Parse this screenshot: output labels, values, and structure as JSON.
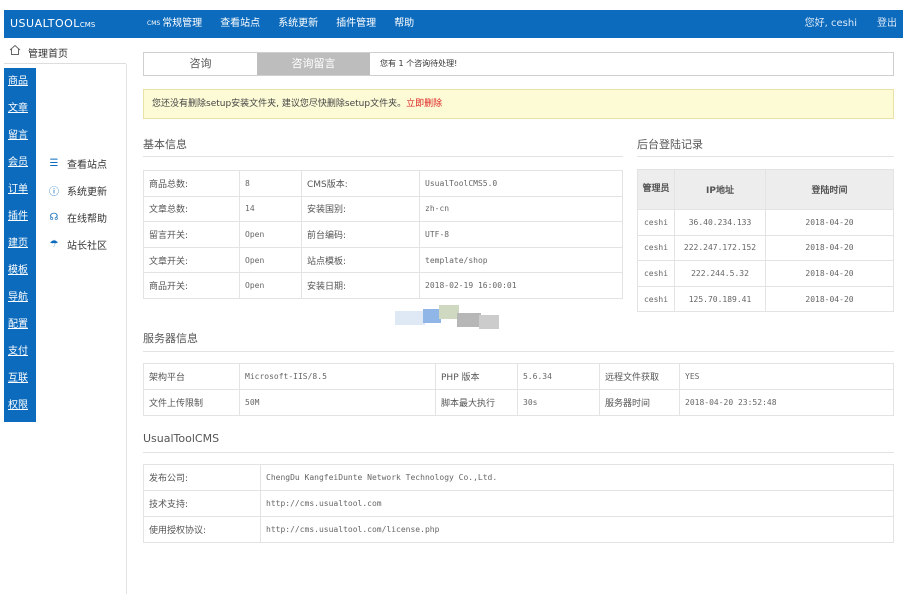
{
  "app": {
    "logo_main": "USUALTOOL",
    "logo_small": "CMS"
  },
  "topnav": {
    "items": [
      {
        "prefix": "CMS",
        "label": "常规管理"
      },
      {
        "prefix": "",
        "label": "查看站点"
      },
      {
        "prefix": "",
        "label": "系统更新"
      },
      {
        "prefix": "",
        "label": "插件管理"
      },
      {
        "prefix": "",
        "label": "帮助"
      }
    ],
    "greeting": "您好, ceshi",
    "logout": "登出"
  },
  "home": {
    "label": "管理首页",
    "icon": "home-icon"
  },
  "left_menu": [
    "商品",
    "文章",
    "留言",
    "会员",
    "订单",
    "插件",
    "建页",
    "模板",
    "导航",
    "配置",
    "支付",
    "互联",
    "权限"
  ],
  "submenu": [
    {
      "icon": "menu-icon",
      "glyph": "☰",
      "label": "查看站点"
    },
    {
      "icon": "info-icon",
      "glyph": "ⓘ",
      "label": "系统更新"
    },
    {
      "icon": "headset-icon",
      "glyph": "☊",
      "label": "在线帮助"
    },
    {
      "icon": "umbrella-icon",
      "glyph": "☂",
      "label": "站长社区"
    }
  ],
  "tabs": {
    "items": [
      "咨询",
      "咨询留言"
    ],
    "note": "您有 1 个咨询待处理!"
  },
  "alert": {
    "text": "您还没有删除setup安装文件夹, 建议您尽快删除setup文件夹。",
    "link": "立即删除"
  },
  "basic_info": {
    "title": "基本信息",
    "rows": [
      [
        "商品总数:",
        "8",
        "CMS版本:",
        "UsualToolCMS5.0"
      ],
      [
        "文章总数:",
        "14",
        "安装国别:",
        "zh-cn"
      ],
      [
        "留言开关:",
        "Open",
        "前台编码:",
        "UTF-8"
      ],
      [
        "文章开关:",
        "Open",
        "站点模板:",
        "template/shop"
      ],
      [
        "商品开关:",
        "Open",
        "安装日期:",
        "2018-02-19 16:00:01"
      ]
    ]
  },
  "login_log": {
    "title": "后台登陆记录",
    "headers": [
      "管理员",
      "IP地址",
      "登陆时间"
    ],
    "rows": [
      [
        "ceshi",
        "36.40.234.133",
        "2018-04-20"
      ],
      [
        "ceshi",
        "222.247.172.152",
        "2018-04-20"
      ],
      [
        "ceshi",
        "222.244.5.32",
        "2018-04-20"
      ],
      [
        "ceshi",
        "125.70.189.41",
        "2018-04-20"
      ]
    ]
  },
  "server_info": {
    "title": "服务器信息",
    "rows": [
      [
        "架构平台",
        "Microsoft-IIS/8.5",
        "PHP 版本",
        "5.6.34",
        "远程文件获取",
        "YES"
      ],
      [
        "文件上传限制",
        "50M",
        "脚本最大执行",
        "30s",
        "服务器时间",
        "2018-04-20 23:52:48"
      ]
    ]
  },
  "product_info": {
    "title": "UsualToolCMS",
    "rows": [
      [
        "发布公司:",
        "ChengDu KangfeiDunte Network Technology Co.,Ltd."
      ],
      [
        "技术支持:",
        "http://cms.usualtool.com"
      ],
      [
        "使用授权协议:",
        "http://cms.usualtool.com/license.php"
      ]
    ]
  },
  "colors": {
    "primary": "#0c6bbd",
    "alert_bg": "#fdfbd6",
    "link_red": "#dd2222"
  }
}
